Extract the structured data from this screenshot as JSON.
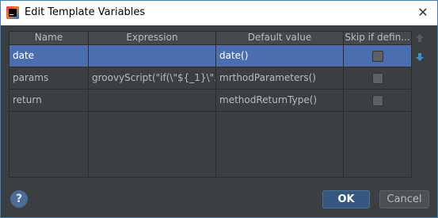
{
  "window": {
    "title": "Edit Template Variables",
    "close_glyph": "✕"
  },
  "table": {
    "headers": [
      "Name",
      "Expression",
      "Default value",
      "Skip if defin..."
    ],
    "rows": [
      {
        "name": "date",
        "expression": "",
        "default": "date()",
        "skip": false,
        "selected": true
      },
      {
        "name": "params",
        "expression": "groovyScript(\"if(\\\"${_1}\\\"...",
        "default": "mrthodParameters()",
        "skip": false,
        "selected": false
      },
      {
        "name": "return",
        "expression": "",
        "default": "methodReturnType()",
        "skip": false,
        "selected": false
      }
    ]
  },
  "side": {
    "up_icon": "arrow-up-icon",
    "down_icon": "arrow-down-icon"
  },
  "footer": {
    "help_label": "?",
    "ok_label": "OK",
    "cancel_label": "Cancel"
  },
  "colors": {
    "selection": "#4b6eaf",
    "background": "#3c3f41",
    "accent": "#3592c4"
  }
}
